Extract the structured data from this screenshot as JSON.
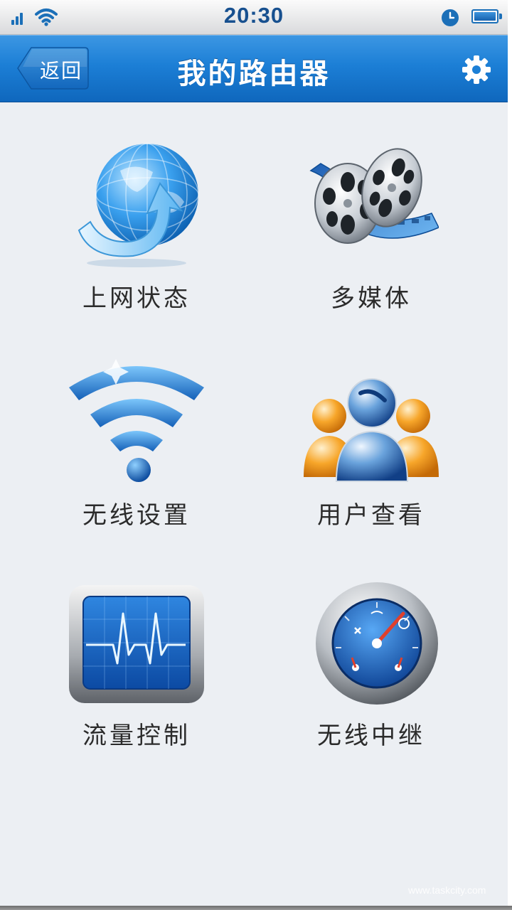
{
  "status_bar": {
    "time": "20:30",
    "icons": [
      "signal-icon",
      "wifi-icon",
      "clock-icon",
      "battery-icon"
    ]
  },
  "nav": {
    "back_label": "返回",
    "title": "我的路由器",
    "settings_icon": "gear-icon"
  },
  "menu": {
    "items": [
      {
        "label": "上网状态",
        "icon": "globe-icon"
      },
      {
        "label": "多媒体",
        "icon": "film-reel-icon"
      },
      {
        "label": "无线设置",
        "icon": "wifi-icon"
      },
      {
        "label": "用户查看",
        "icon": "users-icon"
      },
      {
        "label": "流量控制",
        "icon": "monitor-pulse-icon"
      },
      {
        "label": "无线中继",
        "icon": "gauge-icon"
      }
    ]
  },
  "watermark": "www.taskcity.com",
  "colors": {
    "nav_blue": "#1c7fd6",
    "background": "#eceff3",
    "accent": "#17508f"
  }
}
